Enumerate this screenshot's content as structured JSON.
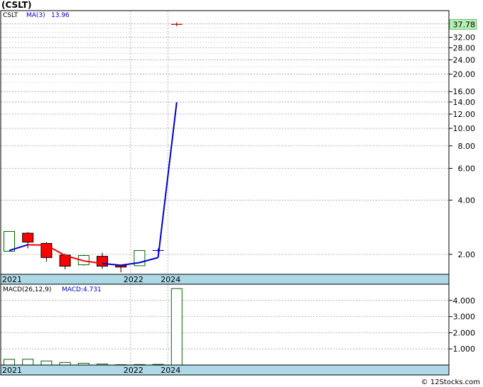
{
  "title": "(CSLT)",
  "watermark": "© 12Stocks.com",
  "chart_data": [
    {
      "type": "candlestick",
      "legend": {
        "symbol": "CSLT",
        "ma_label": "MA(3)",
        "ma_value": "13.96"
      },
      "last_price_label": "37.78",
      "y_scale": "log",
      "ylim": [
        1.55,
        45
      ],
      "y_ticks": [
        {
          "value": 38,
          "label": "38.00"
        },
        {
          "value": 32,
          "label": "32.00"
        },
        {
          "value": 28,
          "label": "28.00"
        },
        {
          "value": 24,
          "label": "24.00"
        },
        {
          "value": 20,
          "label": "20.00"
        },
        {
          "value": 16,
          "label": "16.00"
        },
        {
          "value": 14,
          "label": "14.00"
        },
        {
          "value": 12,
          "label": "12.00"
        },
        {
          "value": 10,
          "label": "10.00"
        },
        {
          "value": 8,
          "label": "8.00"
        },
        {
          "value": 6,
          "label": "6.00"
        },
        {
          "value": 4,
          "label": "4.00"
        },
        {
          "value": 2,
          "label": "2.00"
        }
      ],
      "x_labels": [
        {
          "index": 0,
          "label": "2021"
        },
        {
          "index": 7,
          "label": "2022"
        },
        {
          "index": 9,
          "label": "2024"
        }
      ],
      "candles": [
        {
          "open": 2.08,
          "close": 2.68,
          "high": 2.68,
          "low": 2.08
        },
        {
          "open": 2.62,
          "close": 2.34,
          "high": 2.66,
          "low": 2.16
        },
        {
          "open": 2.3,
          "close": 1.92,
          "high": 2.34,
          "low": 1.82
        },
        {
          "open": 1.98,
          "close": 1.72,
          "high": 2.02,
          "low": 1.65
        },
        {
          "open": 1.75,
          "close": 1.97,
          "high": 1.99,
          "low": 1.73
        },
        {
          "open": 1.95,
          "close": 1.72,
          "high": 2.04,
          "low": 1.66
        },
        {
          "open": 1.74,
          "close": 1.7,
          "high": 1.75,
          "low": 1.59
        },
        {
          "open": 1.73,
          "close": 2.1,
          "high": 2.1,
          "low": 1.73
        },
        {
          "open": 2.1,
          "close": 2.1,
          "high": 2.1,
          "low": 2.1
        },
        {
          "open": 37.78,
          "close": 37.78,
          "high": 37.78,
          "low": 37.78
        }
      ],
      "ma": [
        {
          "index": 0,
          "value": 2.1,
          "color": "#0000cc"
        },
        {
          "index": 1,
          "value": 2.26,
          "color": "#0000cc"
        },
        {
          "index": 2,
          "value": 2.25,
          "color": "#ff0000"
        },
        {
          "index": 3,
          "value": 1.97,
          "color": "#ff0000"
        },
        {
          "index": 4,
          "value": 1.84,
          "color": "#ff0000"
        },
        {
          "index": 5,
          "value": 1.78,
          "color": "#ff0000"
        },
        {
          "index": 6,
          "value": 1.74,
          "color": "#0000cc"
        },
        {
          "index": 7,
          "value": 1.8,
          "color": "#0000cc"
        },
        {
          "index": 8,
          "value": 1.92,
          "color": "#0000cc"
        },
        {
          "index": 9,
          "value": 13.96,
          "color": "#0000cc"
        }
      ]
    },
    {
      "type": "bar",
      "legend": {
        "label": "MACD(26,12,9)",
        "macd_label": "MACD:4.731"
      },
      "ylim": [
        0,
        5.0
      ],
      "y_ticks": [
        {
          "value": 4,
          "label": "4.000"
        },
        {
          "value": 3,
          "label": "3.000"
        },
        {
          "value": 2,
          "label": "2.000"
        },
        {
          "value": 1,
          "label": "1.000"
        }
      ],
      "x_labels": [
        {
          "index": 0,
          "label": "2021"
        },
        {
          "index": 7,
          "label": "2022"
        },
        {
          "index": 9,
          "label": "2024"
        }
      ],
      "values": [
        0.35,
        0.36,
        0.25,
        0.16,
        0.11,
        0.06,
        0.02,
        0.03,
        0.04,
        4.731
      ]
    }
  ]
}
